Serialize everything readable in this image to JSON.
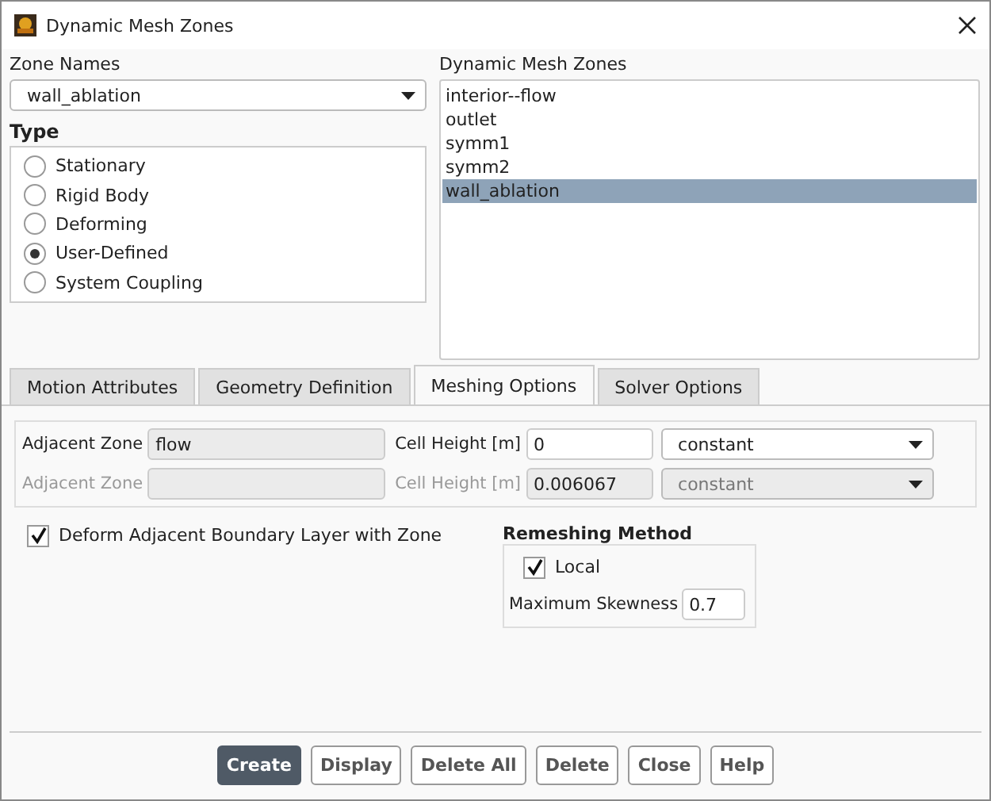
{
  "window": {
    "title": "Dynamic Mesh Zones"
  },
  "zone_names": {
    "label": "Zone Names",
    "value": "wall_ablation"
  },
  "type": {
    "label": "Type",
    "options": [
      {
        "label": "Stationary",
        "selected": false
      },
      {
        "label": "Rigid Body",
        "selected": false
      },
      {
        "label": "Deforming",
        "selected": false
      },
      {
        "label": "User-Defined",
        "selected": true
      },
      {
        "label": "System Coupling",
        "selected": false
      }
    ]
  },
  "dynamic_mesh_zones": {
    "label": "Dynamic Mesh Zones",
    "items": [
      {
        "label": "interior--flow",
        "selected": false
      },
      {
        "label": "outlet",
        "selected": false
      },
      {
        "label": "symm1",
        "selected": false
      },
      {
        "label": "symm2",
        "selected": false
      },
      {
        "label": "wall_ablation",
        "selected": true
      }
    ]
  },
  "tabs": [
    {
      "label": "Motion Attributes",
      "selected": false
    },
    {
      "label": "Geometry Definition",
      "selected": false
    },
    {
      "label": "Meshing Options",
      "selected": true
    },
    {
      "label": "Solver Options",
      "selected": false
    }
  ],
  "zone_rows": [
    {
      "disabled": false,
      "zone_label": "Adjacent Zone",
      "zone_value": "flow",
      "height_label": "Cell Height [m]",
      "height_value": "0",
      "method": "constant"
    },
    {
      "disabled": true,
      "zone_label": "Adjacent Zone",
      "height_label": "Cell Height [m]",
      "height_value": "0.006067",
      "method": "constant"
    }
  ],
  "deform_adjacent": {
    "label": "Deform Adjacent Boundary Layer with Zone",
    "checked": true
  },
  "remeshing": {
    "title": "Remeshing Method",
    "local": {
      "label": "Local",
      "checked": true
    },
    "skewness": {
      "label": "Maximum Skewness",
      "value": "0.7"
    }
  },
  "buttons": [
    {
      "label": "Create",
      "primary": true
    },
    {
      "label": "Display",
      "primary": false
    },
    {
      "label": "Delete All",
      "primary": false
    },
    {
      "label": "Delete",
      "primary": false
    },
    {
      "label": "Close",
      "primary": false
    },
    {
      "label": "Help",
      "primary": false
    }
  ]
}
